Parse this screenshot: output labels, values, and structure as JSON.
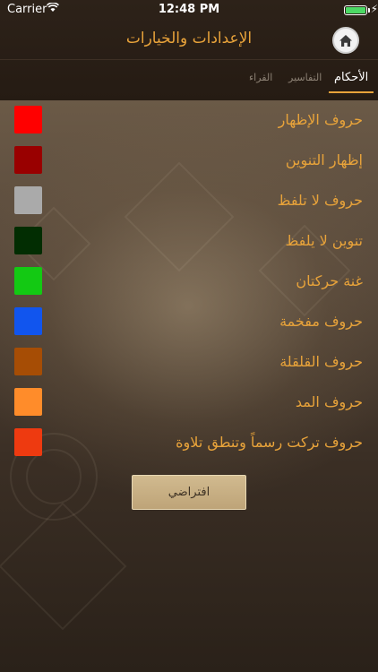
{
  "status": {
    "carrier": "Carrier",
    "time": "12:48 PM"
  },
  "header": {
    "title": "الإعدادات والخيارات",
    "home_icon": "home-icon"
  },
  "tabs": [
    {
      "label": "الأحكام",
      "active": true
    },
    {
      "label": "التفاسير",
      "active": false
    },
    {
      "label": "القراء",
      "active": false
    }
  ],
  "rules": [
    {
      "label": "حروف الإظهار",
      "color": "#ff0000"
    },
    {
      "label": "إظهار التنوين",
      "color": "#990000"
    },
    {
      "label": "حروف لا تلفظ",
      "color": "#aaaaaa"
    },
    {
      "label": "تنوين لا يلفظ",
      "color": "#022d02"
    },
    {
      "label": "غنة حركتان",
      "color": "#13c913"
    },
    {
      "label": "حروف مفخمة",
      "color": "#1155ee"
    },
    {
      "label": "حروف القلقلة",
      "color": "#a64d05"
    },
    {
      "label": "حروف المد",
      "color": "#ff8c2a"
    },
    {
      "label": "حروف تركت رسماً وتنطق تلاوة",
      "color": "#ee3a10"
    }
  ],
  "default_button": "افتراضي",
  "colors": {
    "accent": "#e8a33a",
    "header_bg": "#251b13"
  }
}
